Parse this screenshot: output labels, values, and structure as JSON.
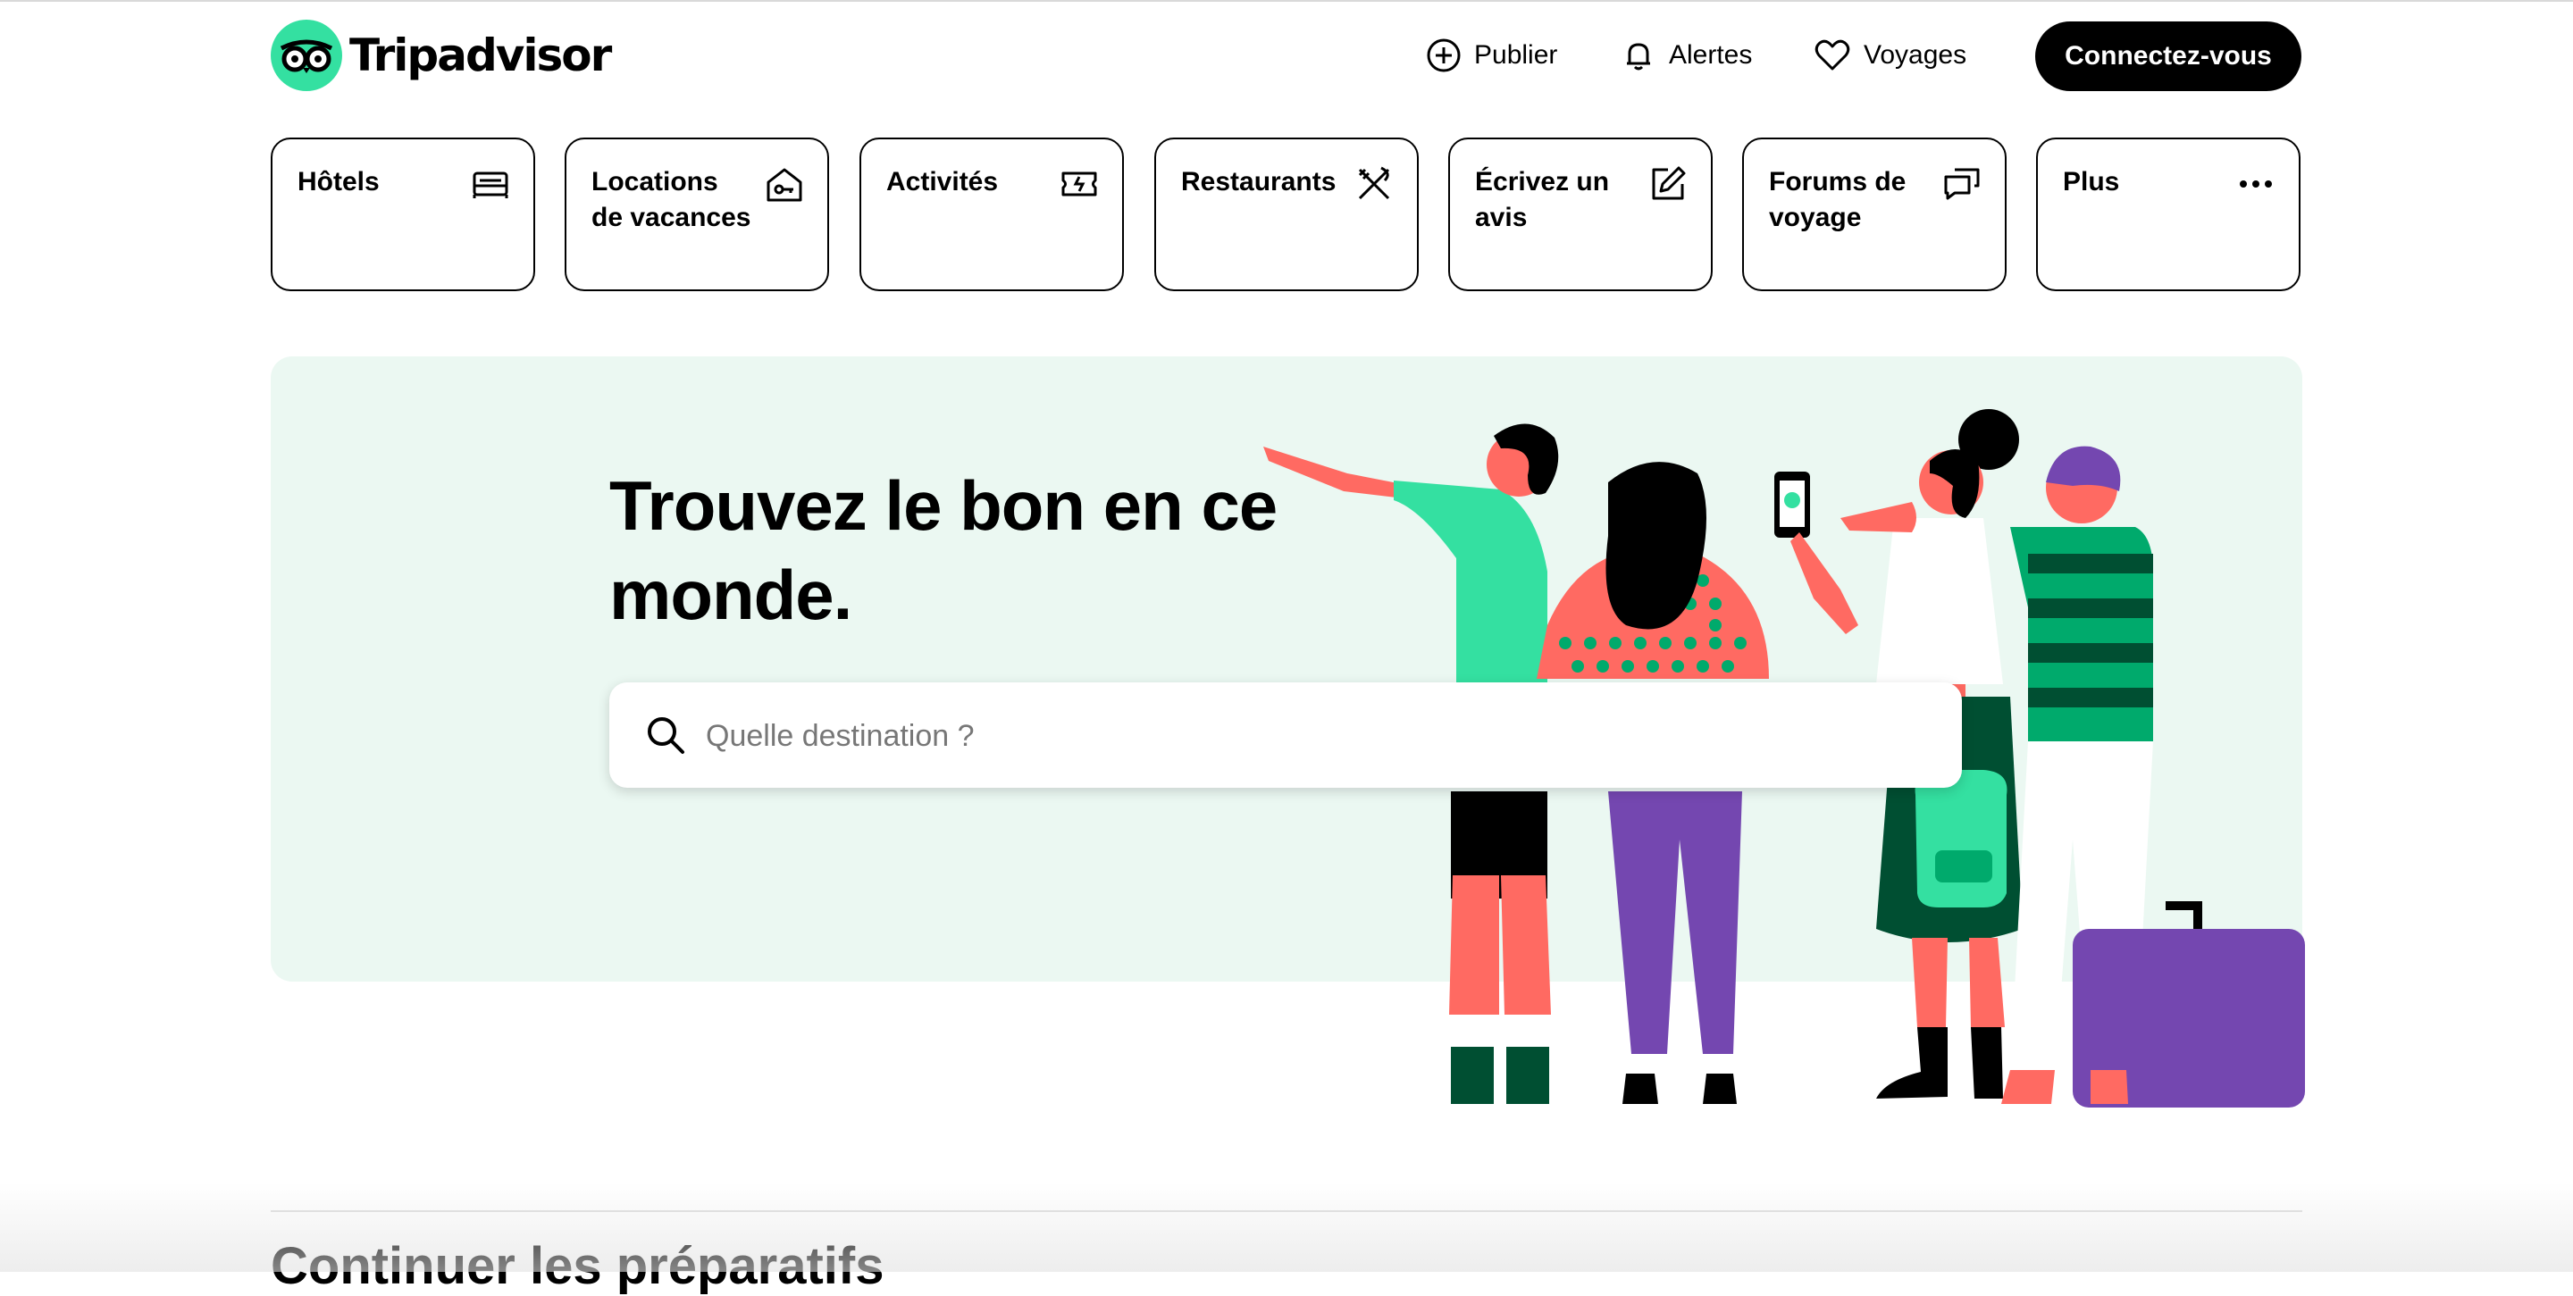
{
  "header": {
    "logo_text": "Tripadvisor",
    "nav": [
      {
        "label": "Publier",
        "icon": "plus-circle-icon"
      },
      {
        "label": "Alertes",
        "icon": "bell-icon"
      },
      {
        "label": "Voyages",
        "icon": "heart-icon"
      }
    ],
    "login_label": "Connectez-vous"
  },
  "categories": [
    {
      "label": "Hôtels",
      "icon": "bed-icon"
    },
    {
      "label": "Locations de vacances",
      "icon": "house-key-icon"
    },
    {
      "label": "Activités",
      "icon": "ticket-icon"
    },
    {
      "label": "Restaurants",
      "icon": "fork-knife-icon"
    },
    {
      "label": "Écrivez un avis",
      "icon": "pencil-square-icon"
    },
    {
      "label": "Forums de voyage",
      "icon": "chat-bubbles-icon"
    },
    {
      "label": "Plus",
      "icon": "more-dots-icon"
    }
  ],
  "hero": {
    "title": "Trouvez le bon en ce monde.",
    "search_placeholder": "Quelle destination ?"
  },
  "section": {
    "title": "Continuer les préparatifs"
  },
  "colors": {
    "brand_green": "#34e0a1",
    "hero_bg": "#ebf8f2",
    "dark_green": "#004f32",
    "coral": "#ff6a62",
    "purple": "#7447b0",
    "mid_green": "#00aa6c"
  }
}
